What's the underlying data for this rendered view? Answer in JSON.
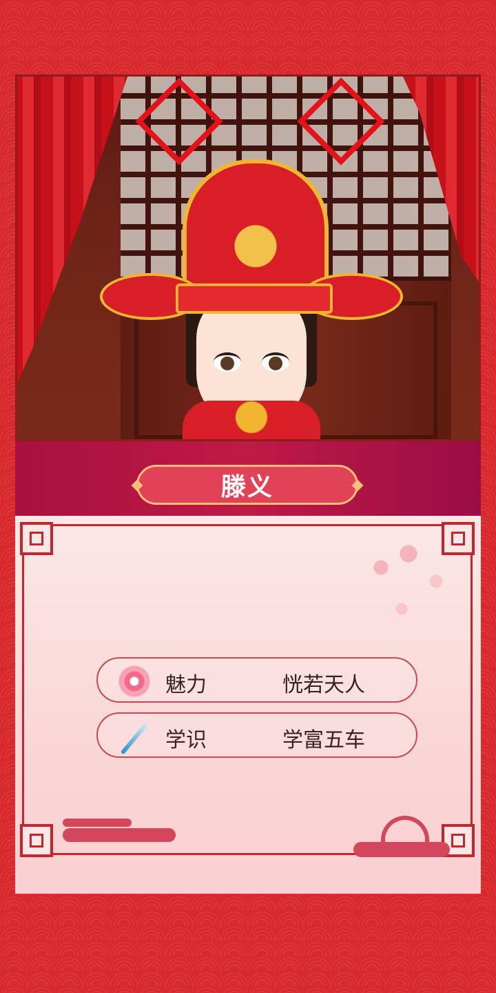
{
  "character": {
    "name": "滕义"
  },
  "stats": [
    {
      "icon": "plum-blossom-icon",
      "label": "魅力",
      "value": "恍若天人"
    },
    {
      "icon": "brush-pen-icon",
      "label": "学识",
      "value": "学富五车"
    }
  ],
  "scene": {
    "decorations": [
      "double-happiness-icon",
      "double-happiness-icon"
    ]
  },
  "colors": {
    "background": "#d72a2e",
    "banner": "#a9103f",
    "name_plate": "#e24258",
    "card": "#fbe8e6",
    "border": "#c9242c"
  }
}
